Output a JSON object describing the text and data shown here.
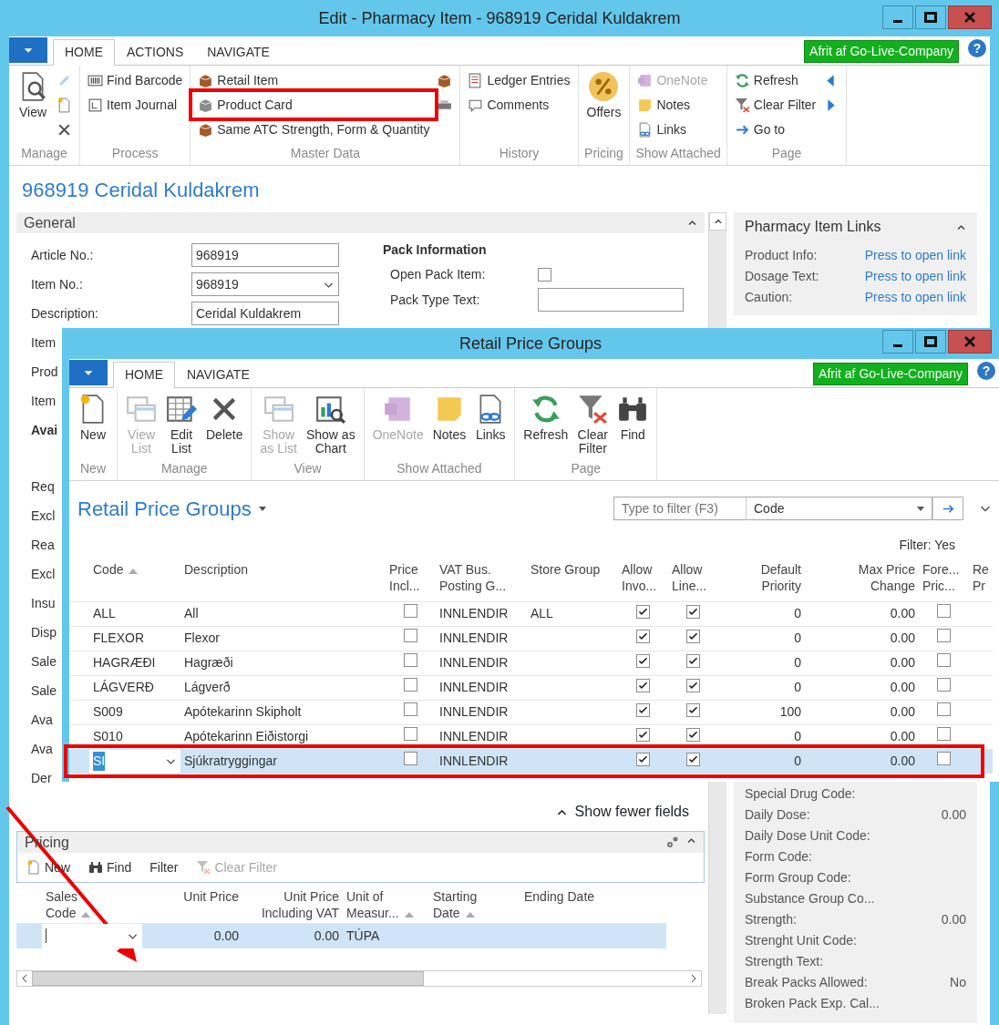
{
  "window": {
    "title": "Edit - Pharmacy Item - 968919 Ceridal Kuldakrem"
  },
  "ribbon": {
    "tabs": [
      {
        "label": "HOME",
        "selected": true
      },
      {
        "label": "ACTIONS",
        "selected": false
      },
      {
        "label": "NAVIGATE",
        "selected": false
      }
    ],
    "company": "Afrit af Go-Live-Company",
    "help": "?",
    "groups": [
      {
        "label": "Manage",
        "items": [
          {
            "kind": "large",
            "label": "View",
            "disabled": false
          },
          {
            "kind": "small",
            "disabled": true
          },
          {
            "kind": "small",
            "disabled": false
          },
          {
            "kind": "small",
            "disabled": false
          }
        ]
      },
      {
        "label": "Process",
        "items": [
          {
            "kind": "small",
            "label": "Find Barcode",
            "disabled": false
          },
          {
            "kind": "small",
            "label": "Item Journal",
            "disabled": false
          }
        ]
      },
      {
        "label": "Master Data",
        "items": [
          {
            "kind": "small",
            "label": "Retail Item",
            "disabled": false
          },
          {
            "kind": "small",
            "label": "Product Card",
            "disabled": false
          },
          {
            "kind": "small",
            "label": "Same ATC Strength, Form & Quantity",
            "disabled": false
          },
          {
            "kind": "small",
            "disabled": false
          },
          {
            "kind": "small",
            "disabled": false
          }
        ]
      },
      {
        "label": "History",
        "items": [
          {
            "kind": "small",
            "label": "Ledger Entries",
            "disabled": false
          },
          {
            "kind": "small",
            "label": "Comments",
            "disabled": false
          }
        ]
      },
      {
        "label": "Pricing",
        "items": [
          {
            "kind": "large",
            "label": "Offers",
            "disabled": false
          }
        ]
      },
      {
        "label": "Show Attached",
        "items": [
          {
            "kind": "small",
            "label": "OneNote",
            "disabled": true
          },
          {
            "kind": "small",
            "label": "Notes",
            "disabled": false
          },
          {
            "kind": "small",
            "label": "Links",
            "disabled": false
          }
        ]
      },
      {
        "label": "Page",
        "items": [
          {
            "kind": "small",
            "label": "Refresh",
            "disabled": false
          },
          {
            "kind": "small",
            "label": "Clear Filter",
            "disabled": false
          },
          {
            "kind": "small",
            "label": "Go to",
            "disabled": false
          },
          {
            "kind": "small",
            "disabled": false
          },
          {
            "kind": "small",
            "disabled": false
          }
        ]
      }
    ]
  },
  "page_title": "968919 Ceridal Kuldakrem",
  "general": {
    "title": "General",
    "fields": [
      {
        "label": "Article No.:",
        "value": "968919",
        "kind": "text"
      },
      {
        "label": "Item No.:",
        "value": "968919",
        "kind": "dropdown"
      },
      {
        "label": "Description:",
        "value": "Ceridal Kuldakrem",
        "kind": "text"
      }
    ],
    "partial_labels": [
      {
        "text": "Item",
        "kind": "field"
      },
      {
        "text": "Prod",
        "kind": "field"
      },
      {
        "text": "Item",
        "kind": "field"
      },
      {
        "text": "Avai",
        "kind": "heading"
      },
      {
        "text": "Req",
        "kind": "field"
      },
      {
        "text": "Excl",
        "kind": "field"
      },
      {
        "text": "Rea",
        "kind": "field"
      },
      {
        "text": "Excl",
        "kind": "field"
      },
      {
        "text": "Insu",
        "kind": "field"
      },
      {
        "text": "Disp",
        "kind": "field"
      },
      {
        "text": "Sale",
        "kind": "field"
      },
      {
        "text": "Sale",
        "kind": "field"
      },
      {
        "text": "Ava",
        "kind": "field"
      },
      {
        "text": "Ava",
        "kind": "field"
      },
      {
        "text": "Der",
        "kind": "field"
      }
    ],
    "pack": {
      "title": "Pack Information",
      "open_pack_label": "Open Pack Item:",
      "open_pack_checked": false,
      "type_label": "Pack Type Text:"
    }
  },
  "show_fewer": "Show fewer fields",
  "pricing": {
    "title": "Pricing",
    "toolbar": [
      {
        "label": "New",
        "disabled": false
      },
      {
        "label": "Find",
        "disabled": false
      },
      {
        "label": "Filter",
        "disabled": false
      },
      {
        "label": "Clear Filter",
        "disabled": true
      }
    ],
    "columns": [
      {
        "label": "Sales\nCode",
        "sort_mark": true
      },
      {
        "label": "Unit Price",
        "sort_mark": false
      },
      {
        "label": "Unit Price\nIncluding VAT",
        "sort_mark": false
      },
      {
        "label": "Unit of\nMeasur...",
        "sort_mark": true
      },
      {
        "label": "Starting\nDate",
        "sort_mark": true
      },
      {
        "label": "Ending Date",
        "sort_mark": false
      }
    ],
    "rows": [
      {
        "selected": true,
        "unit_price": "0.00",
        "unit_price_incl_vat": "0.00",
        "unit_of_measure": "TÚPA"
      }
    ]
  },
  "links": {
    "title": "Pharmacy Item Links",
    "items": [
      {
        "label": "Product Info:",
        "link": "Press to open link"
      },
      {
        "label": "Dosage Text:",
        "link": "Press to open link"
      },
      {
        "label": "Caution:",
        "link": "Press to open link"
      }
    ]
  },
  "attributes": [
    {
      "label": "Special Drug Code:"
    },
    {
      "label": "Daily Dose:",
      "value": "0.00"
    },
    {
      "label": "Daily Dose Unit Code:"
    },
    {
      "label": "Form Code:"
    },
    {
      "label": "Form Group Code:"
    },
    {
      "label": "Substance Group Co..."
    },
    {
      "label": "Strength:",
      "value": "0.00"
    },
    {
      "label": "Strenght Unit Code:"
    },
    {
      "label": "Strength Text:"
    },
    {
      "label": "Break Packs Allowed:",
      "value": "No"
    },
    {
      "label": "Broken Pack Exp. Cal..."
    }
  ],
  "list_window": {
    "title": "Retail Price Groups",
    "ribbon": {
      "tabs": [
        {
          "label": "HOME",
          "selected": true
        },
        {
          "label": "NAVIGATE",
          "selected": false
        }
      ],
      "company": "Afrit af Go-Live-Company",
      "help": "?",
      "groups": [
        {
          "label": "New",
          "items": [
            {
              "kind": "large",
              "label": "New",
              "disabled": false
            }
          ]
        },
        {
          "label": "Manage",
          "items": [
            {
              "kind": "large",
              "label": "View\nList",
              "disabled": true
            },
            {
              "kind": "large",
              "label": "Edit\nList",
              "disabled": false
            },
            {
              "kind": "large",
              "label": "Delete",
              "disabled": false
            }
          ]
        },
        {
          "label": "View",
          "items": [
            {
              "kind": "large",
              "label": "Show\nas List",
              "disabled": true
            },
            {
              "kind": "large",
              "label": "Show as\nChart",
              "disabled": false
            }
          ]
        },
        {
          "label": "Show Attached",
          "items": [
            {
              "kind": "large",
              "label": "OneNote",
              "disabled": true
            },
            {
              "kind": "large",
              "label": "Notes",
              "disabled": false
            },
            {
              "kind": "large",
              "label": "Links",
              "disabled": false
            }
          ]
        },
        {
          "label": "Page",
          "items": [
            {
              "kind": "large",
              "label": "Refresh",
              "disabled": false
            },
            {
              "kind": "large",
              "label": "Clear\nFilter",
              "disabled": false
            },
            {
              "kind": "large",
              "label": "Find",
              "disabled": false
            }
          ]
        }
      ]
    },
    "list_title": "Retail Price Groups",
    "filter_placeholder": "Type to filter (F3)",
    "filter_field": "Code",
    "filter_status": "Filter: Yes",
    "columns": [
      {
        "label": "Code",
        "sort_mark": true
      },
      {
        "label": "Description",
        "sort_mark": false
      },
      {
        "label": "Price\nIncl...",
        "sort_mark": false
      },
      {
        "label": "VAT Bus.\nPosting G...",
        "sort_mark": false
      },
      {
        "label": "Store Group",
        "sort_mark": false
      },
      {
        "label": "Allow\nInvo...",
        "sort_mark": false
      },
      {
        "label": "Allow\nLine...",
        "sort_mark": false
      },
      {
        "label": "Default\nPriority",
        "sort_mark": false
      },
      {
        "label": "Max Price\nChange",
        "sort_mark": false
      },
      {
        "label": "Fore...\nPric...",
        "sort_mark": false
      },
      {
        "label": "Re\nPr",
        "sort_mark": false
      }
    ],
    "rows": [
      {
        "code": "ALL",
        "description": "All",
        "price_incl_vat": false,
        "vat_bus_posting_group": "INNLENDIR",
        "store_group": "ALL",
        "allow_invoice_disc": true,
        "allow_line_disc": true,
        "default_priority": "0",
        "max_price_change": "0.00",
        "fore_price": false,
        "selected": false
      },
      {
        "code": "FLEXOR",
        "description": "Flexor",
        "price_incl_vat": false,
        "vat_bus_posting_group": "INNLENDIR",
        "allow_invoice_disc": true,
        "allow_line_disc": true,
        "default_priority": "0",
        "max_price_change": "0.00",
        "fore_price": false,
        "selected": false
      },
      {
        "code": "HAGRÆÐI",
        "description": "Hagræði",
        "price_incl_vat": false,
        "vat_bus_posting_group": "INNLENDIR",
        "allow_invoice_disc": true,
        "allow_line_disc": true,
        "default_priority": "0",
        "max_price_change": "0.00",
        "fore_price": false,
        "selected": false
      },
      {
        "code": "LÁGVERÐ",
        "description": "Lágverð",
        "price_incl_vat": false,
        "vat_bus_posting_group": "INNLENDIR",
        "allow_invoice_disc": true,
        "allow_line_disc": true,
        "default_priority": "0",
        "max_price_change": "0.00",
        "fore_price": false,
        "selected": false
      },
      {
        "code": "S009",
        "description": "Apótekarinn Skipholt",
        "price_incl_vat": false,
        "vat_bus_posting_group": "INNLENDIR",
        "allow_invoice_disc": true,
        "allow_line_disc": true,
        "default_priority": "100",
        "max_price_change": "0.00",
        "fore_price": false,
        "selected": false
      },
      {
        "code": "S010",
        "description": "Apótekarinn Eiðistorgi",
        "price_incl_vat": false,
        "vat_bus_posting_group": "INNLENDIR",
        "allow_invoice_disc": true,
        "allow_line_disc": true,
        "default_priority": "0",
        "max_price_change": "0.00",
        "fore_price": false,
        "selected": false
      },
      {
        "code": "SI",
        "description": "Sjúkratryggingar",
        "price_incl_vat": false,
        "vat_bus_posting_group": "INNLENDIR",
        "allow_invoice_disc": true,
        "allow_line_disc": true,
        "default_priority": "0",
        "max_price_change": "0.00",
        "fore_price": false,
        "selected": true
      }
    ]
  }
}
